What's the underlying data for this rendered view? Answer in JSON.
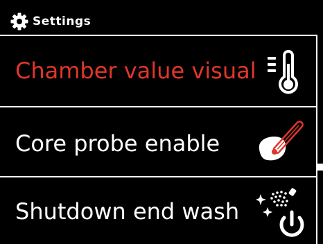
{
  "header": {
    "title": "Settings",
    "icon": "gear-icon"
  },
  "menu": {
    "items": [
      {
        "label": "Chamber value visualizat",
        "icon": "thermometer-icon",
        "color": "#e0362c",
        "selected": true
      },
      {
        "label": "Core probe enable",
        "icon": "core-probe-icon",
        "color": "#ffffff",
        "selected": false
      },
      {
        "label": "Shutdown end wash",
        "icon": "wash-shutdown-icon",
        "color": "#ffffff",
        "selected": false
      }
    ]
  },
  "colors": {
    "background": "#000000",
    "highlight": "#e0362c",
    "text": "#ffffff"
  }
}
